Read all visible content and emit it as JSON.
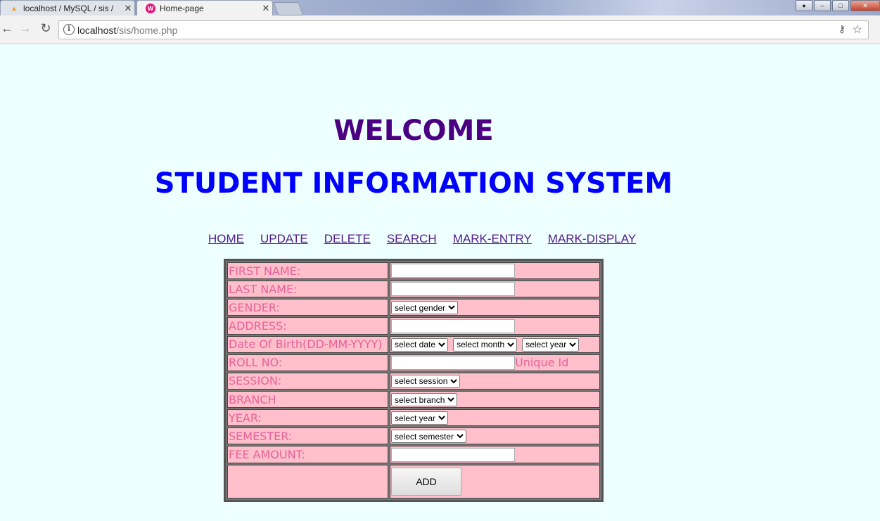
{
  "browser": {
    "tabs": [
      {
        "title": "localhost / MySQL / sis /",
        "favicon": "pma-icon",
        "active": false
      },
      {
        "title": "Home-page",
        "favicon": "wamp-icon",
        "active": true
      }
    ],
    "close_glyph": "✕",
    "url_host": "localhost",
    "url_path": "/sis/home.php"
  },
  "page": {
    "heading": "WELCOME",
    "subheading": "STUDENT INFORMATION SYSTEM",
    "menu": [
      "HOME",
      "UPDATE",
      "DELETE",
      "SEARCH",
      "MARK-ENTRY",
      "MARK-DISPLAY"
    ]
  },
  "form": {
    "first_name_label": "FIRST NAME:",
    "last_name_label": "LAST NAME:",
    "gender_label": "GENDER:",
    "gender_select": "select gender",
    "address_label": "ADDRESS:",
    "dob_label": "Date Of Birth(DD-MM-YYYY)",
    "dob_date_select": "select date",
    "dob_month_select": "select month",
    "dob_year_select": "select year",
    "roll_label": "ROLL NO:",
    "roll_hint": "Unique Id",
    "session_label": "SESSION:",
    "session_select": "select session",
    "branch_label": "BRANCH",
    "branch_select": "select branch",
    "year_label": "YEAR:",
    "year_select": "select year",
    "semester_label": "SEMESTER:",
    "semester_select": "select semester",
    "fee_label": "FEE AMOUNT:",
    "add_button": "ADD"
  },
  "colors": {
    "page_bg": "#eeffff",
    "heading": "#4b0082",
    "subheading": "#0000ff",
    "form_cell_bg": "#ffc0cb",
    "form_label": "#e8609a"
  }
}
